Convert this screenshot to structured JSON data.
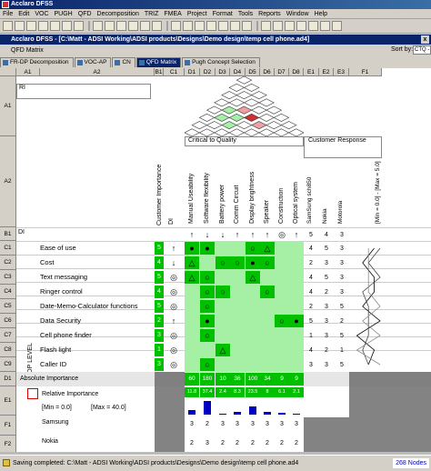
{
  "window": {
    "title": "Acclaro DFSS"
  },
  "menu": [
    "File",
    "Edit",
    "VOC",
    "PUGH",
    "QFD",
    "Decomposition",
    "TRIZ",
    "FMEA",
    "Project",
    "Format",
    "Tools",
    "Reports",
    "Window",
    "Help"
  ],
  "document": {
    "title": "Acclaro DFSS - [C:\\Matt - ADSI Working\\ADSI products\\Designs\\Demo design\\temp cell phone.ad4]"
  },
  "subheader": {
    "title": "QFD Matrix",
    "sort_label": "Sort by:",
    "sort_value": "CTQ -"
  },
  "tabs": [
    {
      "label": "FR-DP Decomposition",
      "active": false
    },
    {
      "label": "VOC-AP",
      "active": false
    },
    {
      "label": "CN",
      "active": false
    },
    {
      "label": "QFD Matrix",
      "active": true
    },
    {
      "label": "Pugh Concept Selection",
      "active": false
    }
  ],
  "columns": [
    "A1",
    "A2",
    "B1",
    "C1",
    "D1",
    "D2",
    "D3",
    "D4",
    "D5",
    "D6",
    "D7",
    "D8",
    "E1",
    "E2",
    "E3",
    "F1"
  ],
  "rows": [
    "A1",
    "A2",
    "B1",
    "C1",
    "C2",
    "C3",
    "C4",
    "C5",
    "C6",
    "C7",
    "C8",
    "C9",
    "D1",
    "E1",
    "F1",
    "F2"
  ],
  "corner_label": "RI",
  "headers": {
    "customer_importance": "Customer Importance",
    "di": "DI",
    "critical_to_quality": "Critical to Quality",
    "customer_response": "Customer Response",
    "b1_label": "DI"
  },
  "ctq_columns": [
    "Manual Useability",
    "Software flexibility",
    "Battery power",
    "Comm Circuit",
    "Display brightness",
    "Speaker",
    "Construction",
    "Optical system"
  ],
  "response_columns": [
    "SamSung sch850",
    "Nokia",
    "Motorola",
    "[Min = 0.0] - [Max = 5.0]"
  ],
  "improvement_arrows": [
    "↑",
    "↓",
    "↓",
    "↑",
    "↑",
    "↑",
    "◎",
    "↑"
  ],
  "response_arrows": [
    "5",
    "4",
    "3"
  ],
  "top_level_label": "TOP LEVEL",
  "customer_needs": [
    {
      "label": "Ease of use",
      "importance": "5",
      "di": "↑",
      "rel": [
        "●",
        "●",
        "",
        "",
        "○",
        "△",
        "",
        ""
      ],
      "resp": [
        "4",
        "5",
        "3"
      ]
    },
    {
      "label": "Cost",
      "importance": "4",
      "di": "↓",
      "rel": [
        "△",
        "",
        "○",
        "○",
        "●",
        "○",
        "",
        ""
      ],
      "resp": [
        "2",
        "3",
        "3"
      ]
    },
    {
      "label": "Text messaging",
      "importance": "5",
      "di": "◎",
      "rel": [
        "△",
        "○",
        "",
        "",
        "△",
        "",
        "",
        ""
      ],
      "resp": [
        "4",
        "5",
        "3"
      ]
    },
    {
      "label": "Ringer control",
      "importance": "4",
      "di": "◎",
      "rel": [
        "",
        "○",
        "○",
        "",
        "",
        "○",
        "",
        ""
      ],
      "resp": [
        "4",
        "2",
        "3"
      ]
    },
    {
      "label": "Date-Memo-Calculator functions",
      "importance": "5",
      "di": "◎",
      "rel": [
        "",
        "○",
        "",
        "",
        "",
        "",
        "",
        ""
      ],
      "resp": [
        "2",
        "3",
        "5"
      ]
    },
    {
      "label": "Data Security",
      "importance": "2",
      "di": "↑",
      "rel": [
        "",
        "●",
        "",
        "",
        "",
        "",
        "○",
        "●"
      ],
      "resp": [
        "5",
        "3",
        "2"
      ]
    },
    {
      "label": "Cell phone finder",
      "importance": "3",
      "di": "◎",
      "rel": [
        "",
        "○",
        "",
        "",
        "",
        "",
        "",
        ""
      ],
      "resp": [
        "1",
        "3",
        "5"
      ]
    },
    {
      "label": "Flash light",
      "importance": "1",
      "di": "◎",
      "rel": [
        "",
        "",
        "△",
        "",
        "",
        "",
        "",
        ""
      ],
      "resp": [
        "4",
        "2",
        "1"
      ]
    },
    {
      "label": "Caller ID",
      "importance": "3",
      "di": "◎",
      "rel": [
        "",
        "○",
        "",
        "",
        "",
        "",
        "",
        ""
      ],
      "resp": [
        "3",
        "3",
        "5"
      ]
    }
  ],
  "absolute_importance": {
    "label": "Absolute Importance",
    "values": [
      "60",
      "180",
      "10",
      "36",
      "100",
      "34",
      "9",
      "9"
    ]
  },
  "relative_importance": {
    "label": "Relative Importance",
    "values": [
      "11.8",
      "37.4",
      "2.4",
      "8.3",
      "23.5",
      "8",
      "6.1",
      "2.1"
    ]
  },
  "relative_range": {
    "min": "[Min = 0.0]",
    "max": "[Max = 40.0]"
  },
  "competitors": [
    {
      "label": "Samsung",
      "values": [
        "3",
        "2",
        "3",
        "3",
        "3",
        "3",
        "3",
        "3"
      ]
    },
    {
      "label": "Nokia",
      "values": [
        "2",
        "3",
        "2",
        "2",
        "2",
        "2",
        "2",
        "2"
      ]
    }
  ],
  "status": {
    "message": "Saving completed: C:\\Matt - ADSI Working\\ADSI products\\Designs\\Demo design\\temp cell phone.ad4",
    "nodes": "268 Nodes"
  },
  "colors": {
    "titlebar": "#0a246a",
    "strong_green": "#00c000",
    "light_green": "#a6f0a6",
    "roof_red": "#d03030",
    "roof_pink": "#f0a0a0"
  }
}
